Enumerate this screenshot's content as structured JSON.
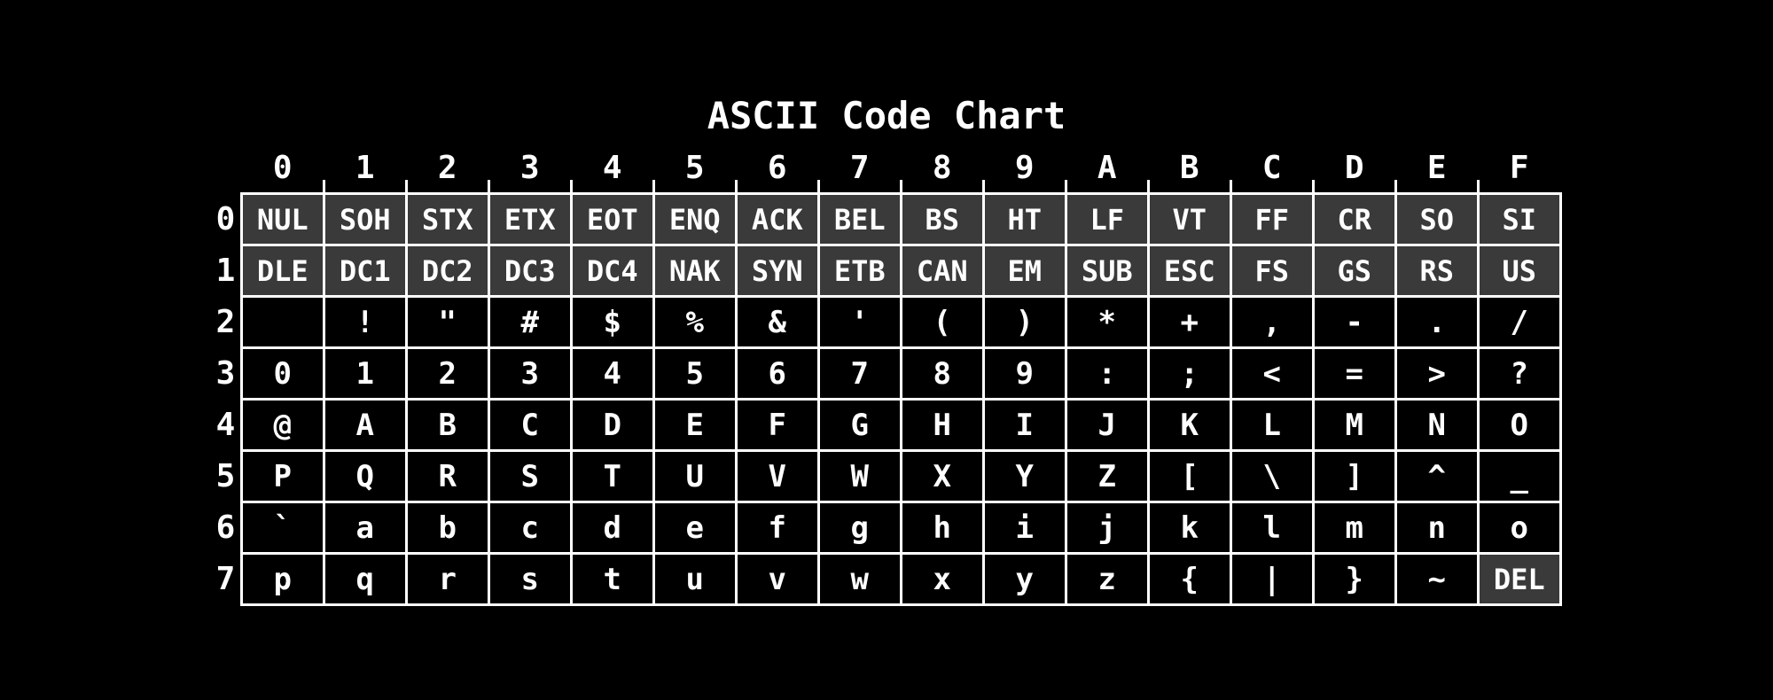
{
  "title": "ASCII Code Chart",
  "col_headers": [
    "0",
    "1",
    "2",
    "3",
    "4",
    "5",
    "6",
    "7",
    "8",
    "9",
    "A",
    "B",
    "C",
    "D",
    "E",
    "F"
  ],
  "row_headers": [
    "0",
    "1",
    "2",
    "3",
    "4",
    "5",
    "6",
    "7"
  ],
  "rows": [
    [
      {
        "v": "NUL",
        "c": true
      },
      {
        "v": "SOH",
        "c": true
      },
      {
        "v": "STX",
        "c": true
      },
      {
        "v": "ETX",
        "c": true
      },
      {
        "v": "EOT",
        "c": true
      },
      {
        "v": "ENQ",
        "c": true
      },
      {
        "v": "ACK",
        "c": true
      },
      {
        "v": "BEL",
        "c": true
      },
      {
        "v": "BS",
        "c": true
      },
      {
        "v": "HT",
        "c": true
      },
      {
        "v": "LF",
        "c": true
      },
      {
        "v": "VT",
        "c": true
      },
      {
        "v": "FF",
        "c": true
      },
      {
        "v": "CR",
        "c": true
      },
      {
        "v": "SO",
        "c": true
      },
      {
        "v": "SI",
        "c": true
      }
    ],
    [
      {
        "v": "DLE",
        "c": true
      },
      {
        "v": "DC1",
        "c": true
      },
      {
        "v": "DC2",
        "c": true
      },
      {
        "v": "DC3",
        "c": true
      },
      {
        "v": "DC4",
        "c": true
      },
      {
        "v": "NAK",
        "c": true
      },
      {
        "v": "SYN",
        "c": true
      },
      {
        "v": "ETB",
        "c": true
      },
      {
        "v": "CAN",
        "c": true
      },
      {
        "v": "EM",
        "c": true
      },
      {
        "v": "SUB",
        "c": true
      },
      {
        "v": "ESC",
        "c": true
      },
      {
        "v": "FS",
        "c": true
      },
      {
        "v": "GS",
        "c": true
      },
      {
        "v": "RS",
        "c": true
      },
      {
        "v": "US",
        "c": true
      }
    ],
    [
      {
        "v": " ",
        "c": false
      },
      {
        "v": "!",
        "c": false
      },
      {
        "v": "\"",
        "c": false
      },
      {
        "v": "#",
        "c": false
      },
      {
        "v": "$",
        "c": false
      },
      {
        "v": "%",
        "c": false
      },
      {
        "v": "&",
        "c": false
      },
      {
        "v": "'",
        "c": false
      },
      {
        "v": "(",
        "c": false
      },
      {
        "v": ")",
        "c": false
      },
      {
        "v": "*",
        "c": false
      },
      {
        "v": "+",
        "c": false
      },
      {
        "v": ",",
        "c": false
      },
      {
        "v": "-",
        "c": false
      },
      {
        "v": ".",
        "c": false
      },
      {
        "v": "/",
        "c": false
      }
    ],
    [
      {
        "v": "0",
        "c": false
      },
      {
        "v": "1",
        "c": false
      },
      {
        "v": "2",
        "c": false
      },
      {
        "v": "3",
        "c": false
      },
      {
        "v": "4",
        "c": false
      },
      {
        "v": "5",
        "c": false
      },
      {
        "v": "6",
        "c": false
      },
      {
        "v": "7",
        "c": false
      },
      {
        "v": "8",
        "c": false
      },
      {
        "v": "9",
        "c": false
      },
      {
        "v": ":",
        "c": false
      },
      {
        "v": ";",
        "c": false
      },
      {
        "v": "<",
        "c": false
      },
      {
        "v": "=",
        "c": false
      },
      {
        "v": ">",
        "c": false
      },
      {
        "v": "?",
        "c": false
      }
    ],
    [
      {
        "v": "@",
        "c": false
      },
      {
        "v": "A",
        "c": false
      },
      {
        "v": "B",
        "c": false
      },
      {
        "v": "C",
        "c": false
      },
      {
        "v": "D",
        "c": false
      },
      {
        "v": "E",
        "c": false
      },
      {
        "v": "F",
        "c": false
      },
      {
        "v": "G",
        "c": false
      },
      {
        "v": "H",
        "c": false
      },
      {
        "v": "I",
        "c": false
      },
      {
        "v": "J",
        "c": false
      },
      {
        "v": "K",
        "c": false
      },
      {
        "v": "L",
        "c": false
      },
      {
        "v": "M",
        "c": false
      },
      {
        "v": "N",
        "c": false
      },
      {
        "v": "O",
        "c": false
      }
    ],
    [
      {
        "v": "P",
        "c": false
      },
      {
        "v": "Q",
        "c": false
      },
      {
        "v": "R",
        "c": false
      },
      {
        "v": "S",
        "c": false
      },
      {
        "v": "T",
        "c": false
      },
      {
        "v": "U",
        "c": false
      },
      {
        "v": "V",
        "c": false
      },
      {
        "v": "W",
        "c": false
      },
      {
        "v": "X",
        "c": false
      },
      {
        "v": "Y",
        "c": false
      },
      {
        "v": "Z",
        "c": false
      },
      {
        "v": "[",
        "c": false
      },
      {
        "v": "\\",
        "c": false
      },
      {
        "v": "]",
        "c": false
      },
      {
        "v": "^",
        "c": false
      },
      {
        "v": "_",
        "c": false
      }
    ],
    [
      {
        "v": "`",
        "c": false
      },
      {
        "v": "a",
        "c": false
      },
      {
        "v": "b",
        "c": false
      },
      {
        "v": "c",
        "c": false
      },
      {
        "v": "d",
        "c": false
      },
      {
        "v": "e",
        "c": false
      },
      {
        "v": "f",
        "c": false
      },
      {
        "v": "g",
        "c": false
      },
      {
        "v": "h",
        "c": false
      },
      {
        "v": "i",
        "c": false
      },
      {
        "v": "j",
        "c": false
      },
      {
        "v": "k",
        "c": false
      },
      {
        "v": "l",
        "c": false
      },
      {
        "v": "m",
        "c": false
      },
      {
        "v": "n",
        "c": false
      },
      {
        "v": "o",
        "c": false
      }
    ],
    [
      {
        "v": "p",
        "c": false
      },
      {
        "v": "q",
        "c": false
      },
      {
        "v": "r",
        "c": false
      },
      {
        "v": "s",
        "c": false
      },
      {
        "v": "t",
        "c": false
      },
      {
        "v": "u",
        "c": false
      },
      {
        "v": "v",
        "c": false
      },
      {
        "v": "w",
        "c": false
      },
      {
        "v": "x",
        "c": false
      },
      {
        "v": "y",
        "c": false
      },
      {
        "v": "z",
        "c": false
      },
      {
        "v": "{",
        "c": false
      },
      {
        "v": "|",
        "c": false
      },
      {
        "v": "}",
        "c": false
      },
      {
        "v": "~",
        "c": false
      },
      {
        "v": "DEL",
        "c": true
      }
    ]
  ]
}
